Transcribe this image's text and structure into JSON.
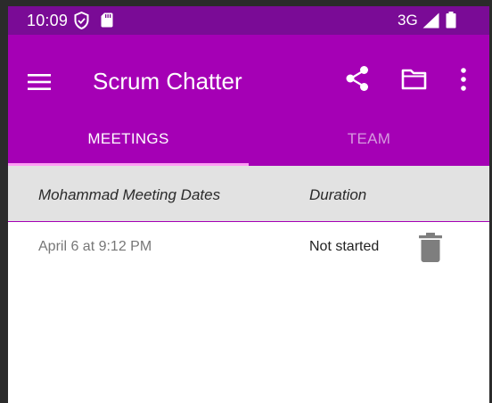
{
  "status_bar": {
    "time": "10:09",
    "network": "3G",
    "icons": [
      "shield-icon",
      "sd-card-icon",
      "signal-icon",
      "battery-icon"
    ]
  },
  "app_bar": {
    "title": "Scrum Chatter",
    "actions": [
      "menu-icon",
      "share-icon",
      "folder-icon",
      "more-vert-icon"
    ]
  },
  "tabs": [
    {
      "label": "MEETINGS",
      "selected": true
    },
    {
      "label": "TEAM",
      "selected": false
    }
  ],
  "list_header": {
    "dates_label": "Mohammad Meeting Dates",
    "duration_label": "Duration"
  },
  "meetings": [
    {
      "date": "April 6 at 9:12 PM",
      "duration": "Not started",
      "action_icon": "delete-icon"
    }
  ],
  "colors": {
    "status_bar": "#7a0b96",
    "primary": "#a500b5",
    "tab_indicator": "#ff9df5",
    "header_bg": "#e2e2e2",
    "inactive_tab": "#d69adf"
  }
}
